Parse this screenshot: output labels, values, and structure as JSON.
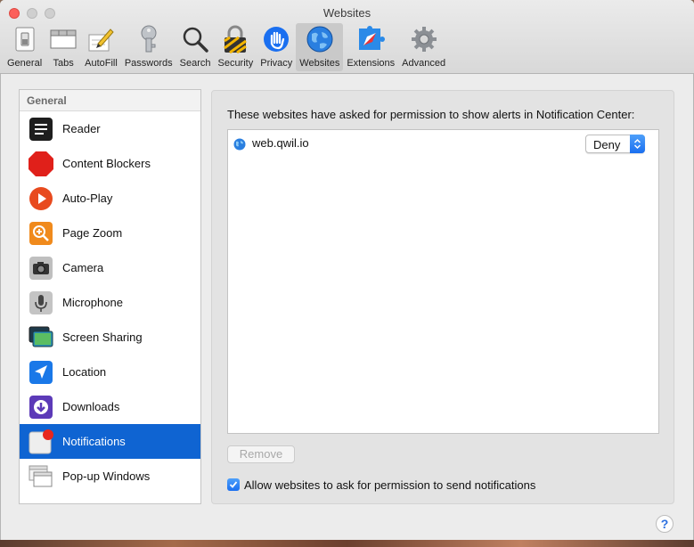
{
  "window": {
    "title": "Websites"
  },
  "toolbar": {
    "items": [
      {
        "label": "General",
        "icon": "general-switch-icon"
      },
      {
        "label": "Tabs",
        "icon": "tabs-icon"
      },
      {
        "label": "AutoFill",
        "icon": "pencil-form-icon"
      },
      {
        "label": "Passwords",
        "icon": "key-icon"
      },
      {
        "label": "Search",
        "icon": "magnifier-icon"
      },
      {
        "label": "Security",
        "icon": "padlock-icon"
      },
      {
        "label": "Privacy",
        "icon": "hand-icon"
      },
      {
        "label": "Websites",
        "icon": "globe-icon",
        "selected": true
      },
      {
        "label": "Extensions",
        "icon": "puzzle-compass-icon"
      },
      {
        "label": "Advanced",
        "icon": "gear-icon"
      }
    ]
  },
  "sidebar": {
    "header": "General",
    "items": [
      {
        "label": "Reader",
        "icon": "reader-icon"
      },
      {
        "label": "Content Blockers",
        "icon": "stop-sign-icon"
      },
      {
        "label": "Auto-Play",
        "icon": "play-icon"
      },
      {
        "label": "Page Zoom",
        "icon": "zoom-icon"
      },
      {
        "label": "Camera",
        "icon": "camera-icon"
      },
      {
        "label": "Microphone",
        "icon": "microphone-icon"
      },
      {
        "label": "Screen Sharing",
        "icon": "screen-sharing-icon"
      },
      {
        "label": "Location",
        "icon": "location-arrow-icon"
      },
      {
        "label": "Downloads",
        "icon": "download-icon"
      },
      {
        "label": "Notifications",
        "icon": "notification-badge-icon",
        "selected": true
      },
      {
        "label": "Pop-up Windows",
        "icon": "popup-windows-icon"
      }
    ]
  },
  "main": {
    "prompt": "These websites have asked for permission to show alerts in Notification Center:",
    "sites": [
      {
        "name": "web.qwil.io",
        "setting": "Deny"
      }
    ],
    "remove_label": "Remove",
    "allow_checkbox": {
      "label": "Allow websites to ask for permission to send notifications",
      "checked": true
    }
  },
  "help_label": "?",
  "colors": {
    "accent": "#0f64d2",
    "close_button": "#fc605b"
  }
}
